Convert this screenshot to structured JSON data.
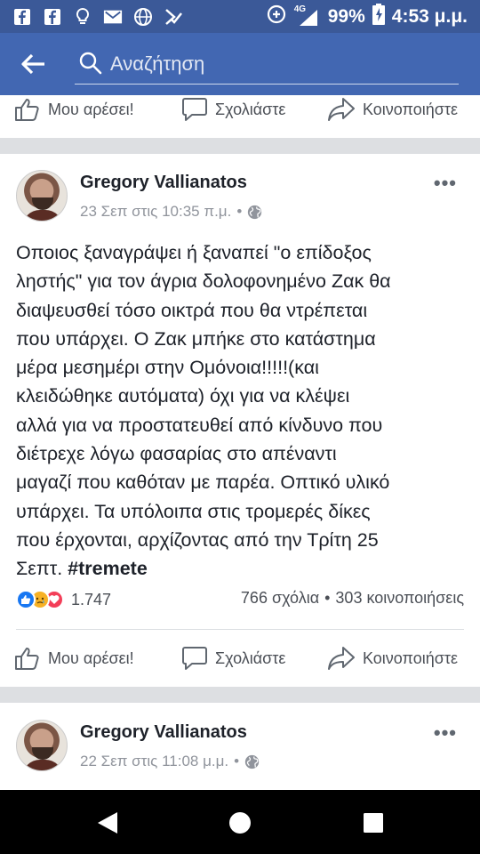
{
  "status_bar": {
    "battery": "99%",
    "time": "4:53 μ.μ.",
    "network": "4G"
  },
  "search": {
    "placeholder": "Αναζήτηση"
  },
  "actions": {
    "like": "Μου αρέσει!",
    "comment": "Σχολιάστε",
    "share": "Κοινοποιήστε"
  },
  "post1": {
    "author": "Gregory Vallianatos",
    "timestamp": "23 Σεπ στις 10:35 π.μ.",
    "separator": "•",
    "text_lines": [
      "Οποιος ξαναγράψει ή ξαναπεί \"ο επίδοξος",
      "ληστής\" για τον άγρια δολοφονημένο Ζακ θα",
      "διαψευσθεί τόσο οικτρά που θα ντρέπεται",
      "που υπάρχει. Ο Ζακ μπήκε στο κατάστημα",
      "μέρα μεσημέρι στην Ομόνοια!!!!!(και",
      "κλειδώθηκε αυτόματα) όχι για να κλέψει",
      "αλλά για να προστατευθεί από κίνδυνο που",
      "διέτρεχε λόγω φασαρίας στο απέναντι",
      "μαγαζί που καθόταν με παρέα. Οπτικό υλικό",
      "υπάρχει. Τα υπόλοιπα στις τρομερές δίκες",
      "που έρχονται, αρχίζοντας από την Τρίτη 25"
    ],
    "last_line_prefix": "Σεπτ. ",
    "hashtag": "#tremete",
    "reaction_count": "1.747",
    "comments": "766 σχόλια",
    "stats_separator": "•",
    "shares": "303 κοινοποιήσεις"
  },
  "post2": {
    "author": "Gregory Vallianatos",
    "timestamp": "22 Σεπ στις 11:08 μ.μ.",
    "separator": "•"
  },
  "colors": {
    "facebook_blue": "#3b5998",
    "header_blue": "#4267b2",
    "like_blue": "#1877f2",
    "love_red": "#f33e58",
    "sad_yellow": "#f7b125"
  },
  "icons": {
    "status_left": [
      "facebook-icon",
      "facebook-icon",
      "lightbulb-icon",
      "mail-icon",
      "globe-icon",
      "check-icon"
    ],
    "status_right": [
      "data-saver-icon",
      "signal-icon",
      "battery-charging-icon"
    ],
    "nav": [
      "back-triangle-icon",
      "home-circle-icon",
      "recents-square-icon"
    ]
  }
}
